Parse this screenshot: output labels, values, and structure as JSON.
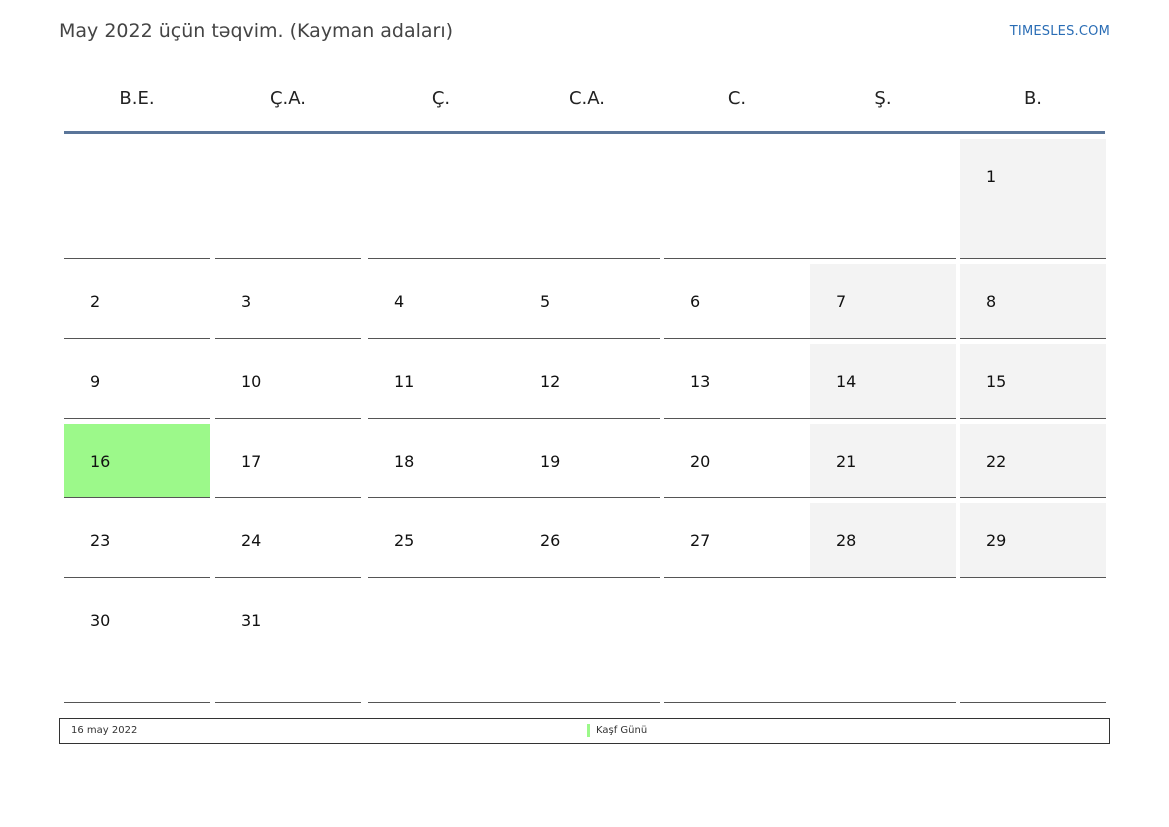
{
  "header": {
    "title": "May 2022 üçün təqvim. (Kayman adaları)",
    "brand": "TIMESLES.COM",
    "brand_color": "#2a6db5"
  },
  "weekdays": [
    "B.E.",
    "Ç.A.",
    "Ç.",
    "C.A.",
    "C.",
    "Ş.",
    "B."
  ],
  "calendar": {
    "month": "May 2022",
    "first_weekday_index": 6,
    "days_in_month": 31,
    "weekend_columns": [
      5,
      6
    ],
    "holiday_days": [
      16
    ],
    "header_rule_color": "#5a7599",
    "weekend_bg": "#f3f3f3",
    "holiday_bg": "#9cf98a"
  },
  "legend": {
    "date": "16 may 2022",
    "name": "Kaşf Günü",
    "swatch_color": "#9cf98a"
  }
}
